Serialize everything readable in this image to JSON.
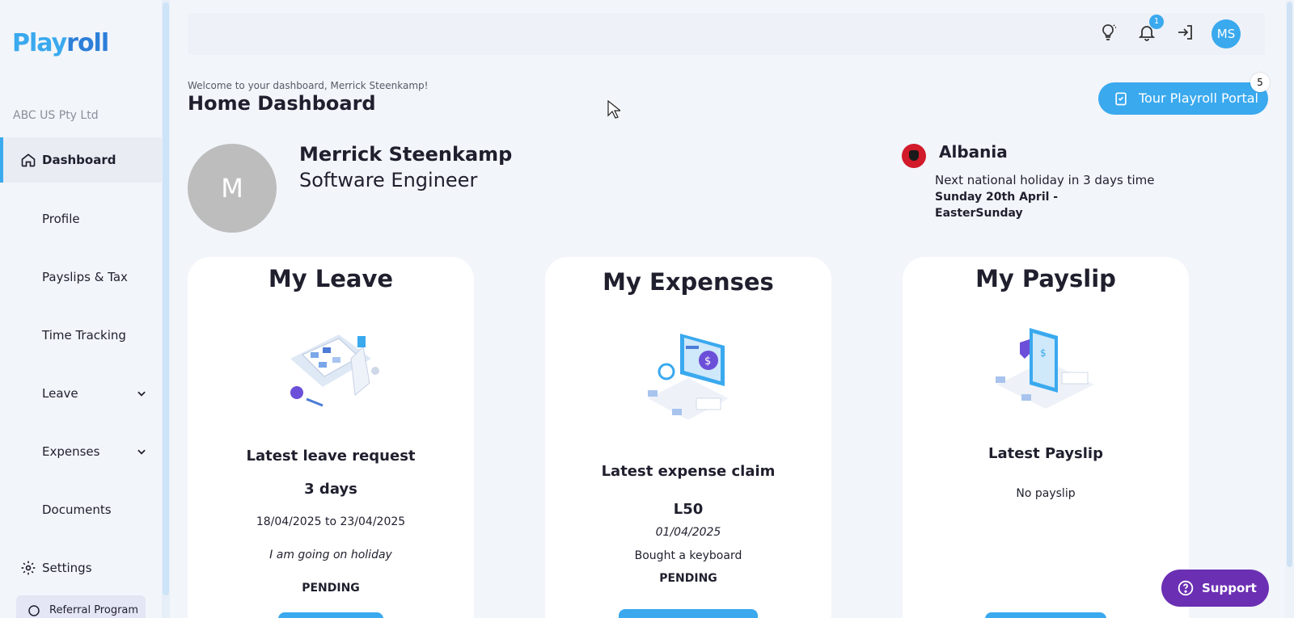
{
  "brand": {
    "part1": "Play",
    "part2": "roll"
  },
  "company": "ABC US Pty Ltd",
  "sidebar": {
    "items": [
      {
        "label": "Dashboard",
        "active": true
      },
      {
        "label": "Profile"
      },
      {
        "label": "Payslips & Tax"
      },
      {
        "label": "Time Tracking"
      },
      {
        "label": "Leave",
        "expandable": true
      },
      {
        "label": "Expenses",
        "expandable": true
      },
      {
        "label": "Documents"
      },
      {
        "label": "Settings"
      }
    ],
    "referral": "Referral Program"
  },
  "topbar": {
    "icons": [
      "lightbulb-icon",
      "bell-icon",
      "logout-icon"
    ],
    "notification_count": "1",
    "user_initials": "MS"
  },
  "header": {
    "welcome": "Welcome to your dashboard, Merrick Steenkamp!",
    "title": "Home Dashboard",
    "tour_label": "Tour Playroll Portal",
    "tour_badge": "5"
  },
  "profile": {
    "initial": "M",
    "name": "Merrick Steenkamp",
    "role": "Software Engineer"
  },
  "country": {
    "name": "Albania",
    "holiday_text": "Next national holiday in 3 days time",
    "holiday_date": "Sunday 20th April - EasterSunday"
  },
  "cards": {
    "leave": {
      "title": "My Leave",
      "subtitle": "Latest leave request",
      "amount": "3 days",
      "dates": "18/04/2025 to 23/04/2025",
      "note": "I am going on holiday",
      "status": "PENDING"
    },
    "expenses": {
      "title": "My Expenses",
      "subtitle": "Latest expense claim",
      "amount": "L50",
      "date": "01/04/2025",
      "description": "Bought a keyboard",
      "status": "PENDING"
    },
    "payslip": {
      "title": "My Payslip",
      "subtitle": "Latest Payslip",
      "empty": "No payslip"
    }
  },
  "support": {
    "label": "Support"
  },
  "colors": {
    "accent": "#3aa9ee",
    "support": "#6b2fb3",
    "flag": "#d11a2a"
  }
}
